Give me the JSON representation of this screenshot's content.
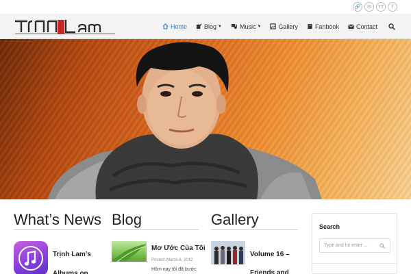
{
  "site": {
    "logo_text": "TrinhLam",
    "logo_colors": {
      "dark": "#2b2b2b",
      "accent": "#c62828"
    }
  },
  "social": [
    {
      "icon": "link-icon",
      "glyph": "🔗"
    },
    {
      "icon": "email-icon",
      "glyph": "✉"
    },
    {
      "icon": "youtube-icon",
      "glyph": "YT"
    },
    {
      "icon": "facebook-icon",
      "glyph": "f"
    }
  ],
  "nav": {
    "items": [
      {
        "label": "Home",
        "icon": "home-icon",
        "active": true
      },
      {
        "label": "Blog",
        "icon": "blog-icon",
        "dropdown": true
      },
      {
        "label": "Music",
        "icon": "music-icon",
        "dropdown": true
      },
      {
        "label": "Gallery",
        "icon": "gallery-icon"
      },
      {
        "label": "Fanbook",
        "icon": "book-icon"
      },
      {
        "label": "Contact",
        "icon": "mail-icon"
      }
    ],
    "active_color": "#2a7fd4"
  },
  "sections": {
    "news": {
      "title": "What’s News",
      "item_title": "Trịnh Lam’s Albums on"
    },
    "blog": {
      "title": "Blog",
      "item_title": "Mơ Ước Của Tôi",
      "item_meta": "Posted: March 6, 2012",
      "item_excerpt": "Hôm nay tôi đã bước"
    },
    "gallery": {
      "title": "Gallery",
      "item_title": "Volume 16 – Friends and"
    }
  },
  "sidebar": {
    "search": {
      "title": "Search",
      "placeholder": "Type and hit enter ..."
    }
  }
}
